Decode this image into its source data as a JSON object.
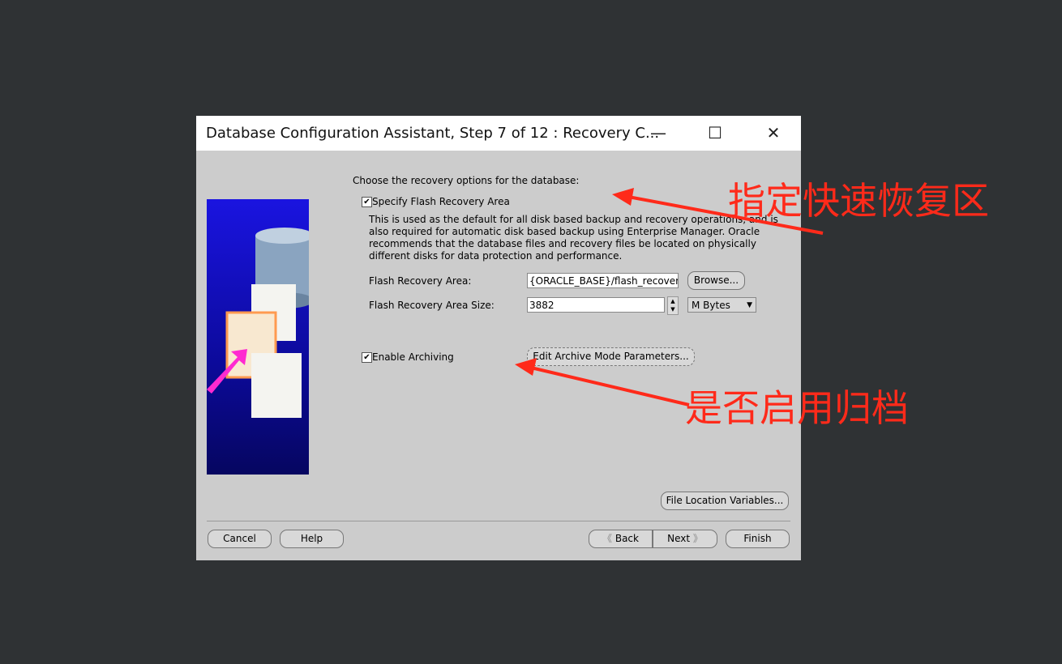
{
  "window": {
    "title": "Database Configuration Assistant, Step 7 of 12 : Recovery C...",
    "minimize": "—",
    "maximize": "☐",
    "close": "✕"
  },
  "main": {
    "prompt": "Choose the recovery options for the database:",
    "flash_checkbox": {
      "label": "Specify Flash Recovery Area",
      "checked": true
    },
    "description": "This is used as the default for all disk based backup and recovery operations, and is also required for automatic disk based backup using Enterprise Manager. Oracle recommends that the database files and recovery files be located on physically different disks for data protection and performance.",
    "flash_area_label": "Flash Recovery Area:",
    "flash_area_value": "{ORACLE_BASE}/flash_recovery_",
    "browse_label": "Browse...",
    "size_label": "Flash Recovery Area Size:",
    "size_value": "3882",
    "unit_value": "M Bytes",
    "archiving_checkbox": {
      "label": "Enable Archiving",
      "checked": true
    },
    "edit_archive_label": "Edit Archive Mode Parameters...",
    "file_location_label": "File Location Variables..."
  },
  "footer": {
    "cancel": "Cancel",
    "help": "Help",
    "back": "Back",
    "next": "Next",
    "finish": "Finish"
  },
  "annotations": {
    "flash": "指定快速恢复区",
    "archive": "是否启用归档",
    "color": "#ff2a1a"
  }
}
